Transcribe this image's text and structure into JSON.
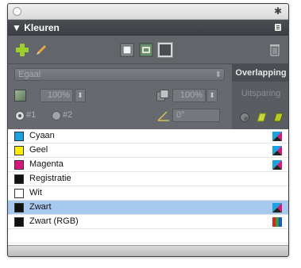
{
  "panel": {
    "title": "▼ Kleuren"
  },
  "colors": {
    "accent_selected": "#a8c9ee",
    "panel_bg": "#62666b"
  },
  "toolbar": {
    "buttons": [
      {
        "name": "new-swatch",
        "icon": "plus-icon"
      },
      {
        "name": "edit-swatch",
        "icon": "pencil-icon"
      },
      {
        "name": "fill",
        "icon": "fill-icon"
      },
      {
        "name": "fill-stroke",
        "icon": "fill-stroke-icon"
      },
      {
        "name": "stroke",
        "icon": "stroke-icon"
      },
      {
        "name": "delete",
        "icon": "trash-icon"
      }
    ]
  },
  "options": {
    "tint_type": "Egaal",
    "tint_percent_1": "100%",
    "tint_percent_2": "100%",
    "radio_1_label": "#1",
    "radio_2_label": "#2",
    "angle": "0°",
    "overlap_header": "Overlapping",
    "knockout_label": "Uitsparing"
  },
  "swatches": [
    {
      "name": "Cyaan",
      "color": "#1aa3e0",
      "type_icon": "cmyk-icon",
      "selected": false
    },
    {
      "name": "Geel",
      "color": "#ffee00",
      "type_icon": "cmyk-icon",
      "selected": false
    },
    {
      "name": "Magenta",
      "color": "#d9147d",
      "type_icon": "cmyk-icon",
      "selected": false
    },
    {
      "name": "Registratie",
      "color": "#111111",
      "type_icon": "",
      "selected": false
    },
    {
      "name": "Wit",
      "color": "#ffffff",
      "type_icon": "",
      "selected": false
    },
    {
      "name": "Zwart",
      "color": "#111111",
      "type_icon": "cmyk-icon",
      "selected": true
    },
    {
      "name": "Zwart (RGB)",
      "color": "#111111",
      "type_icon": "rgb-icon",
      "selected": false
    }
  ]
}
